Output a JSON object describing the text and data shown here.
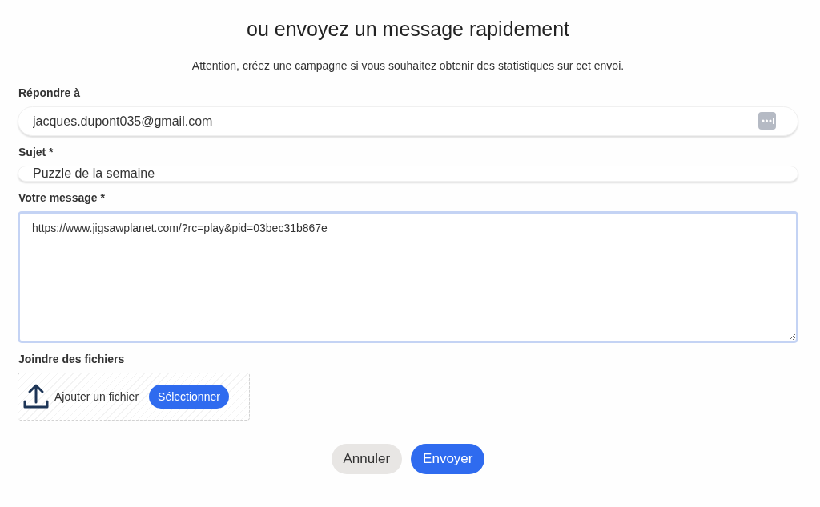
{
  "title": "ou envoyez un message rapidement",
  "notice": "Attention, créez une campagne si vous souhaitez obtenir des statistiques sur cet envoi.",
  "reply_to": {
    "label": "Répondre à",
    "value": "jacques.dupont035@gmail.com"
  },
  "subject": {
    "label": "Sujet *",
    "value": "Puzzle de la semaine"
  },
  "message": {
    "label": "Votre message *",
    "value": "https://www.jigsawplanet.com/?rc=play&pid=03bec31b867e"
  },
  "attachments": {
    "label": "Joindre des fichiers",
    "hint": "Ajouter un fichier",
    "button": "Sélectionner"
  },
  "buttons": [
    {
      "label": "Annuler",
      "kind": "secondary"
    },
    {
      "label": "Envoyer",
      "kind": "primary"
    }
  ]
}
